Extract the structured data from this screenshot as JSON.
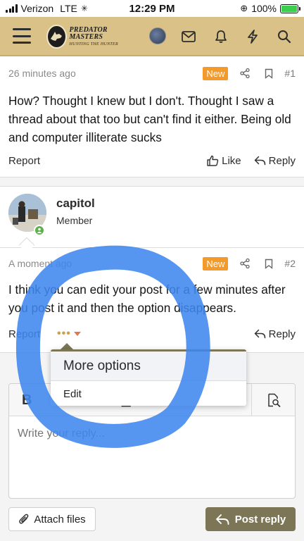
{
  "status_bar": {
    "carrier": "Verizon",
    "network": "LTE",
    "time": "12:29 PM",
    "battery": "100%"
  },
  "header": {
    "logo_title": "PREDATOR MASTERS",
    "logo_subtitle": "HUNTING THE HUNTER",
    "icons": [
      "menu-icon",
      "avatar",
      "mail-icon",
      "bell-icon",
      "bolt-icon",
      "search-icon"
    ],
    "bg_color": "#d9c187"
  },
  "post1": {
    "time": "26 minutes ago",
    "badge": "New",
    "number": "#1",
    "body": "How? Thought I knew but I don't. Thought I saw a thread about that too but can't find it either. Being old and computer illiterate sucks",
    "report": "Report",
    "like": "Like",
    "reply": "Reply"
  },
  "post2": {
    "author": "capitol",
    "role": "Member",
    "time": "A moment ago",
    "badge": "New",
    "number": "#2",
    "body": "I think you can edit your post for a few minutes after you post it and then the option disappears.",
    "report": "Report",
    "more": "•••",
    "reply": "Reply"
  },
  "dropdown": {
    "title": "More options",
    "items": [
      "Edit"
    ]
  },
  "editor": {
    "bold": "B",
    "placeholder": "Write your reply...",
    "attach_label": "Attach files",
    "post_reply_label": "Post reply",
    "accent_color": "#7c7657"
  },
  "annotation": {
    "color": "#3f86ee"
  }
}
